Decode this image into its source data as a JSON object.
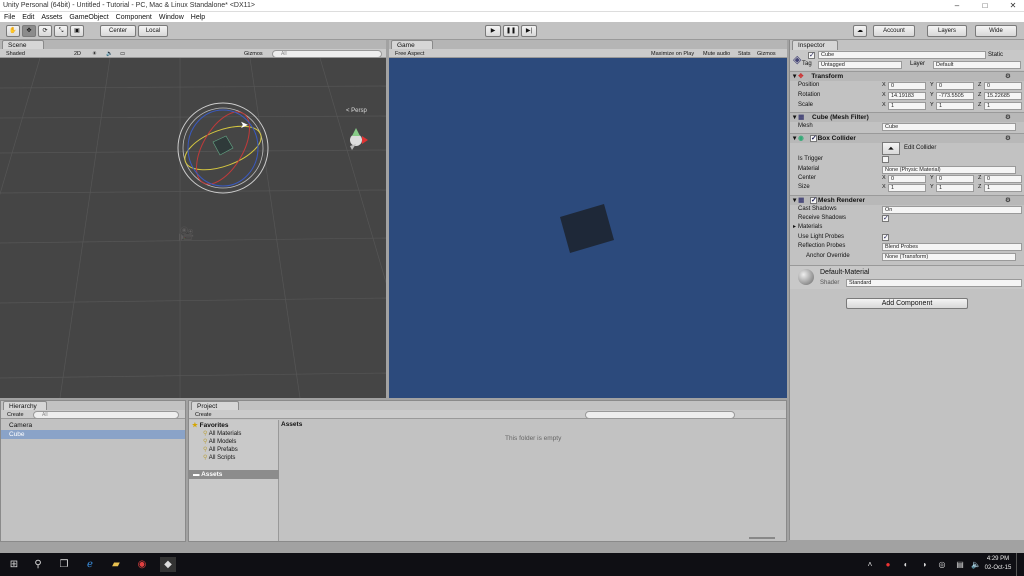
{
  "window": {
    "title": "Unity Personal (64bit) - Untitled - Tutorial - PC, Mac & Linux Standalone* <DX11>",
    "minimize": "–",
    "maximize": "□",
    "close": "✕"
  },
  "menu": [
    "File",
    "Edit",
    "Assets",
    "GameObject",
    "Component",
    "Window",
    "Help"
  ],
  "toolbar": {
    "center": "Center",
    "local": "Local",
    "account": "Account",
    "layers": "Layers",
    "layout": "Wide"
  },
  "scene": {
    "tab": "Scene",
    "shading": "Shaded",
    "mode2d": "2D",
    "gizmos": "Gizmos",
    "search": "All",
    "persp": "< Persp"
  },
  "game": {
    "tab": "Game",
    "aspect": "Free Aspect",
    "maximize": "Maximize on Play",
    "mute": "Mute audio",
    "stats": "Stats",
    "gizmos": "Gizmos"
  },
  "inspector": {
    "tab": "Inspector",
    "object_name": "Cube",
    "static": "Static",
    "tag_label": "Tag",
    "tag": "Untagged",
    "layer_label": "Layer",
    "layer": "Default",
    "transform": {
      "title": "Transform",
      "position_label": "Position",
      "position": [
        "0",
        "0",
        "0"
      ],
      "rotation_label": "Rotation",
      "rotation": [
        "14.19183",
        "-773.5505",
        "15.22685"
      ],
      "scale_label": "Scale",
      "scale": [
        "1",
        "1",
        "1"
      ]
    },
    "mesh_filter": {
      "title": "Cube (Mesh Filter)",
      "mesh_label": "Mesh",
      "mesh": "Cube"
    },
    "box_collider": {
      "title": "Box Collider",
      "edit": "Edit Collider",
      "trigger_label": "Is Trigger",
      "material_label": "Material",
      "material": "None (Physic Material)",
      "center_label": "Center",
      "center": [
        "0",
        "0",
        "0"
      ],
      "size_label": "Size",
      "size": [
        "1",
        "1",
        "1"
      ]
    },
    "mesh_renderer": {
      "title": "Mesh Renderer",
      "cast_label": "Cast Shadows",
      "cast": "On",
      "receive_label": "Receive Shadows",
      "materials_label": "Materials",
      "light_probes_label": "Use Light Probes",
      "reflection_label": "Reflection Probes",
      "reflection": "Blend Probes",
      "anchor_label": "Anchor Override",
      "anchor": "None (Transform)"
    },
    "material": {
      "name": "Default-Material",
      "shader_label": "Shader",
      "shader": "Standard"
    },
    "add_component": "Add Component"
  },
  "hierarchy": {
    "tab": "Hierarchy",
    "create": "Create",
    "search": "All",
    "items": [
      "Camera",
      "Cube"
    ]
  },
  "project": {
    "tab": "Project",
    "create": "Create",
    "favorites": "Favorites",
    "fav_items": [
      "All Materials",
      "All Models",
      "All Prefabs",
      "All Scripts"
    ],
    "assets": "Assets",
    "header": "Assets",
    "empty": "This folder is empty"
  },
  "taskbar": {
    "time": "4:29 PM",
    "date": "02-Oct-15"
  },
  "colors": {
    "scene_bg": "#454545",
    "game_bg": "#2c4a7c",
    "panel": "#c2c2c2",
    "selected": "#8aa3c8"
  }
}
